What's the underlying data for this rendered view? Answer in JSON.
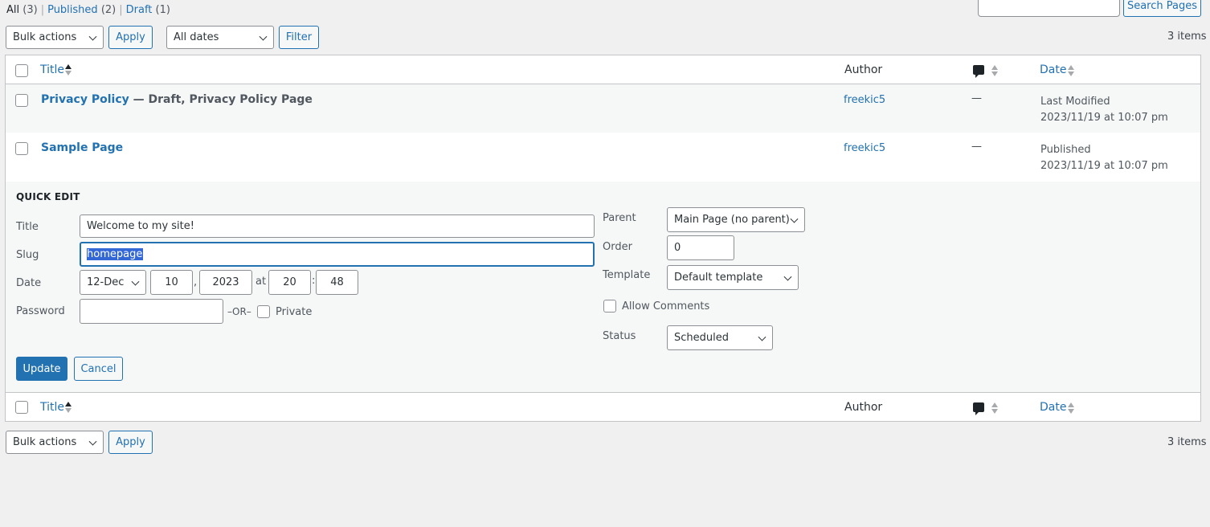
{
  "views": {
    "all_label": "All",
    "all_count": "(3)",
    "published_label": "Published",
    "published_count": "(2)",
    "draft_label": "Draft",
    "draft_count": "(1)",
    "sep": "|"
  },
  "search": {
    "button": "Search Pages",
    "value": ""
  },
  "top_nav": {
    "bulk_actions": "Bulk actions",
    "apply": "Apply",
    "dates": "All dates",
    "filter": "Filter",
    "items_count": "3 items"
  },
  "columns": {
    "title": "Title",
    "author": "Author",
    "date": "Date"
  },
  "rows": [
    {
      "title": "Privacy Policy",
      "state": "— Draft, Privacy Policy Page",
      "author": "freekic5",
      "comments": "—",
      "date_status": "Last Modified",
      "date_value": "2023/11/19 at 10:07 pm"
    },
    {
      "title": "Sample Page",
      "state": "",
      "author": "freekic5",
      "comments": "—",
      "date_status": "Published",
      "date_value": "2023/11/19 at 10:07 pm"
    }
  ],
  "quick_edit": {
    "heading": "QUICK EDIT",
    "title_label": "Title",
    "title_value": "Welcome to my site!",
    "slug_label": "Slug",
    "slug_value": "homepage",
    "date_label": "Date",
    "month": "12-Dec",
    "day": "10",
    "day_sep": ",",
    "year": "2023",
    "at": "at",
    "hour": "20",
    "time_sep": ":",
    "minute": "48",
    "password_label": "Password",
    "password_value": "",
    "or": "–OR–",
    "private_label": "Private",
    "parent_label": "Parent",
    "parent_value": "Main Page (no parent)",
    "order_label": "Order",
    "order_value": "0",
    "template_label": "Template",
    "template_value": "Default template",
    "allow_comments_label": "Allow Comments",
    "status_label": "Status",
    "status_value": "Scheduled",
    "update": "Update",
    "cancel": "Cancel"
  },
  "bottom_nav": {
    "bulk_actions": "Bulk actions",
    "apply": "Apply",
    "items_count": "3 items"
  }
}
